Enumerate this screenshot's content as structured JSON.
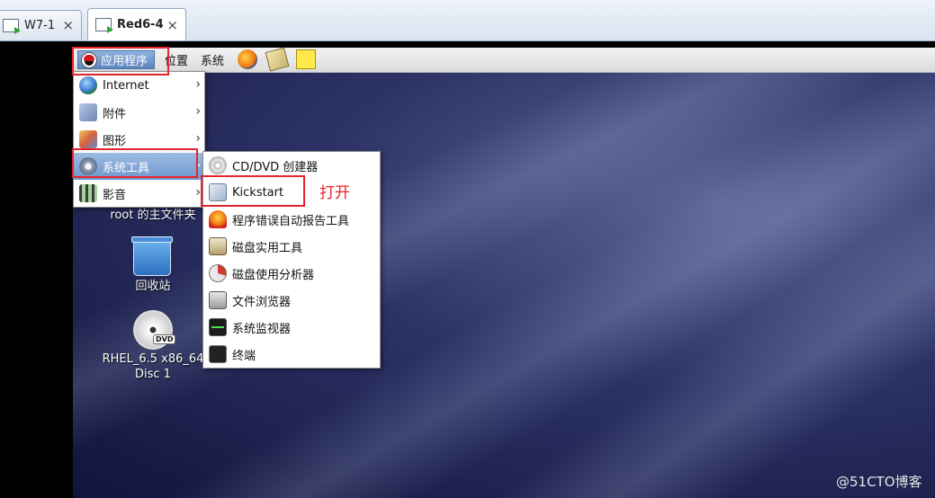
{
  "host_tabs": [
    {
      "label": "W7-1",
      "close": "×",
      "active": false
    },
    {
      "label": "Red6-4",
      "close": "×",
      "active": true
    }
  ],
  "panel": {
    "applications_label": "应用程序",
    "places_label": "位置",
    "system_label": "系统",
    "launchers": [
      "firefox-icon",
      "mail-icon",
      "note-icon"
    ]
  },
  "apps_menu": {
    "items": [
      {
        "label": "Internet",
        "icon": "globe-icon",
        "arrow": "›"
      },
      {
        "label": "附件",
        "icon": "accessories-icon",
        "arrow": "›"
      },
      {
        "label": "图形",
        "icon": "graphics-icon",
        "arrow": "›"
      },
      {
        "label": "系统工具",
        "icon": "system-tools-icon",
        "arrow": "›",
        "highlighted": true
      },
      {
        "label": "影音",
        "icon": "multimedia-icon",
        "arrow": "›"
      }
    ]
  },
  "system_tools_menu": {
    "items": [
      {
        "label": "CD/DVD 创建器",
        "icon": "cd-icon"
      },
      {
        "label": "Kickstart",
        "icon": "kickstart-icon"
      },
      {
        "label": "程序错误自动报告工具",
        "icon": "alarm-icon"
      },
      {
        "label": "磁盘实用工具",
        "icon": "disk-icon"
      },
      {
        "label": "磁盘使用分析器",
        "icon": "pie-icon"
      },
      {
        "label": "文件浏览器",
        "icon": "file-cabinet-icon"
      },
      {
        "label": "系统监视器",
        "icon": "monitor-icon"
      },
      {
        "label": "终端",
        "icon": "terminal-icon"
      }
    ]
  },
  "annotation": "打开",
  "desktop": {
    "home_label": "root 的主文件夹",
    "trash_label": "回收站",
    "dvd_label_line1": "RHEL_6.5 x86_64",
    "dvd_label_line2": "Disc 1",
    "dvd_badge": "DVD"
  },
  "watermark": "@51CTO博客",
  "colors": {
    "highlight_box": "#e5232a",
    "menu_highlight": "#6f98cf"
  }
}
